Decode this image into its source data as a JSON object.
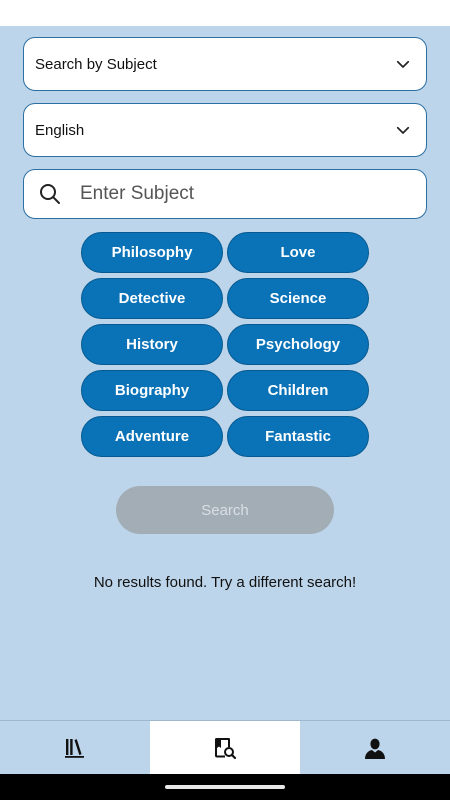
{
  "subject_select": {
    "value": "Search by Subject",
    "icon": "chevron-down-icon"
  },
  "language_select": {
    "value": "English",
    "icon": "chevron-down-icon"
  },
  "search_field": {
    "placeholder": "Enter Subject",
    "value": "",
    "icon": "search-icon"
  },
  "subjects": [
    "Philosophy",
    "Love",
    "Detective",
    "Science",
    "History",
    "Psychology",
    "Biography",
    "Children",
    "Adventure",
    "Fantastic"
  ],
  "search_button": {
    "label": "Search",
    "disabled": true
  },
  "empty_message": "No results found. Try a different search!",
  "bottom_nav": [
    {
      "icon": "library-icon",
      "active": false
    },
    {
      "icon": "book-search-icon",
      "active": true
    },
    {
      "icon": "profile-icon",
      "active": false
    }
  ],
  "colors": {
    "background": "#bdd5ea",
    "chip": "#0a73b8",
    "border": "#2c6fa3",
    "disabled_button": "#a2adb6"
  }
}
